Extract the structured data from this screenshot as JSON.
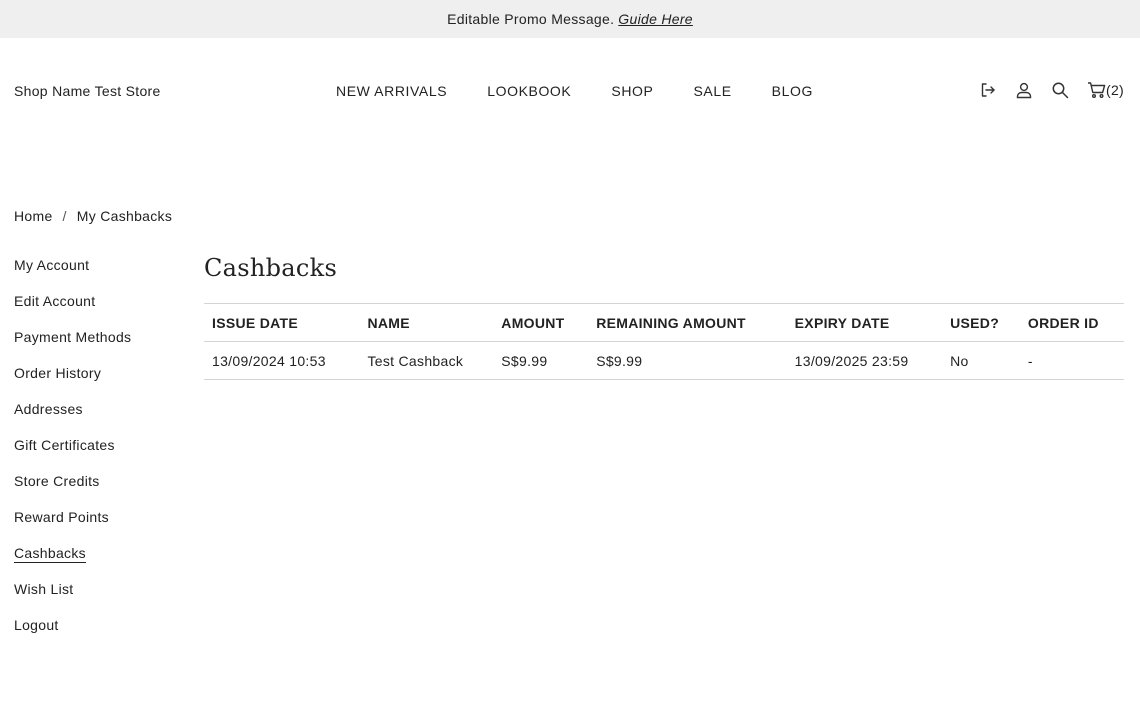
{
  "promo": {
    "message": "Editable Promo Message.",
    "link": "Guide Here"
  },
  "header": {
    "shop_name": "Shop Name Test Store",
    "nav": [
      "NEW ARRIVALS",
      "LOOKBOOK",
      "SHOP",
      "SALE",
      "BLOG"
    ],
    "icons": [
      "logout-icon",
      "user-icon",
      "search-icon",
      "cart-icon"
    ],
    "cart_count": "(2)"
  },
  "breadcrumb": {
    "home": "Home",
    "separator": "/",
    "current": "My Cashbacks"
  },
  "sidebar": {
    "items": [
      {
        "label": "My Account"
      },
      {
        "label": "Edit Account"
      },
      {
        "label": "Payment Methods"
      },
      {
        "label": "Order History"
      },
      {
        "label": "Addresses"
      },
      {
        "label": "Gift Certificates"
      },
      {
        "label": "Store Credits"
      },
      {
        "label": "Reward Points"
      },
      {
        "label": "Cashbacks"
      },
      {
        "label": "Wish List"
      },
      {
        "label": "Logout"
      }
    ],
    "active_index": 8
  },
  "main": {
    "title": "Cashbacks",
    "columns": [
      "ISSUE DATE",
      "NAME",
      "AMOUNT",
      "REMAINING AMOUNT",
      "EXPIRY DATE",
      "USED?",
      "ORDER ID"
    ],
    "rows": [
      [
        "13/09/2024 10:53",
        "Test Cashback",
        "S$9.99",
        "S$9.99",
        "13/09/2025 23:59",
        "No",
        "-"
      ]
    ]
  }
}
